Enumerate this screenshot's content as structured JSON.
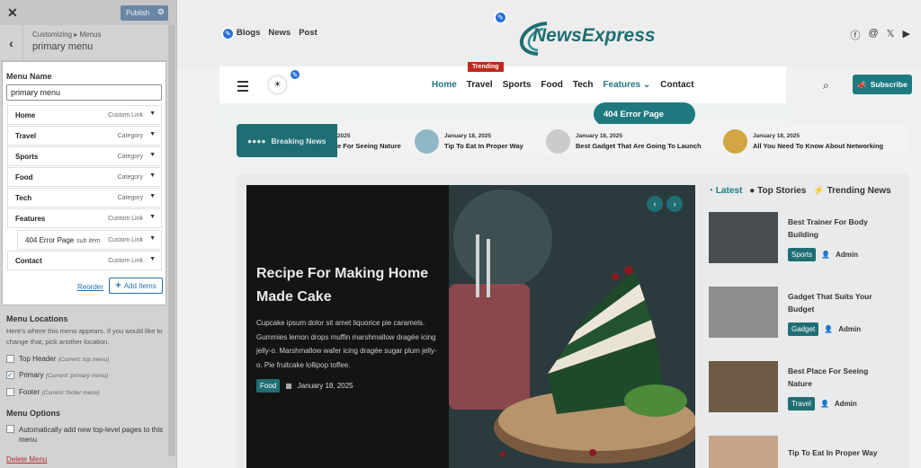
{
  "panel": {
    "publish_label": "Publish",
    "crumb_small": "Customizing ▸ Menus",
    "crumb_title": "primary menu",
    "menu_name_label": "Menu Name",
    "menu_name_value": "primary menu",
    "items": [
      {
        "title": "Home",
        "type": "Custom Link",
        "sub": ""
      },
      {
        "title": "Travel",
        "type": "Category",
        "sub": ""
      },
      {
        "title": "Sports",
        "type": "Category",
        "sub": ""
      },
      {
        "title": "Food",
        "type": "Category",
        "sub": ""
      },
      {
        "title": "Tech",
        "type": "Category",
        "sub": ""
      },
      {
        "title": "Features",
        "type": "Custom Link",
        "sub": ""
      },
      {
        "title": "404 Error Page",
        "type": "Custom Link",
        "sub": "sub item"
      },
      {
        "title": "Contact",
        "type": "Custom Link",
        "sub": ""
      }
    ],
    "reorder_label": "Reorder",
    "add_items_label": "Add Items",
    "locations_heading": "Menu Locations",
    "locations_text": "Here's where this menu appears. If you would like to change that, pick another location.",
    "locations": [
      {
        "label": "Top Header",
        "hint": "(Current: top menu)",
        "checked": false
      },
      {
        "label": "Primary",
        "hint": "(Current: primary menu)",
        "checked": true
      },
      {
        "label": "Footer",
        "hint": "(Current: footer menu)",
        "checked": false
      }
    ],
    "options_heading": "Menu Options",
    "auto_add_label": "Automatically add new top-level pages to this menu",
    "delete_label": "Delete Menu"
  },
  "site": {
    "top_links": [
      "Blogs",
      "News",
      "Post"
    ],
    "logo_text": "NewsExpress",
    "nav": [
      "Home",
      "Travel",
      "Sports",
      "Food",
      "Tech",
      "Features",
      "Contact"
    ],
    "trending_badge": "Trending",
    "dropdown_item": "404 Error Page",
    "subscribe_label": "Subscribe",
    "breaking_label": "Breaking News",
    "ticker": [
      {
        "date": "2025",
        "title": "e For Seeing Nature"
      },
      {
        "date": "January 18, 2025",
        "title": "Tip To Eat In Proper Way"
      },
      {
        "date": "January 18, 2025",
        "title": "Best Gadget That Are Going To Launch"
      },
      {
        "date": "January 18, 2025",
        "title": "All You Need To Know About Networking"
      }
    ],
    "hero": {
      "title": "Recipe For Making Home Made Cake",
      "text": "Cupcake ipsum dolor sit amet liquorice pie caramels. Gummies lemon drops muffin marshmallow dragée icing jelly-o. Marshmallow wafer icing dragée sugar plum jelly-o. Pie fruitcake lollipop toffee.",
      "tag": "Food",
      "date": "January 18, 2025"
    },
    "tabs": [
      "Latest",
      "Top Stories",
      "Trending News"
    ],
    "side": [
      {
        "title": "Best Trainer For Body Building",
        "tag": "Sports",
        "author": "Admin"
      },
      {
        "title": "Gadget That Suits Your Budget",
        "tag": "Gadget",
        "author": "Admin"
      },
      {
        "title": "Best Place For Seeing Nature",
        "tag": "Travel",
        "author": "Admin"
      },
      {
        "title": "Tip To Eat In Proper Way",
        "tag": "",
        "author": ""
      }
    ]
  },
  "colors": {
    "accent": "#1f7a80",
    "trending": "#c0271b",
    "publish": "#6a86a5"
  }
}
